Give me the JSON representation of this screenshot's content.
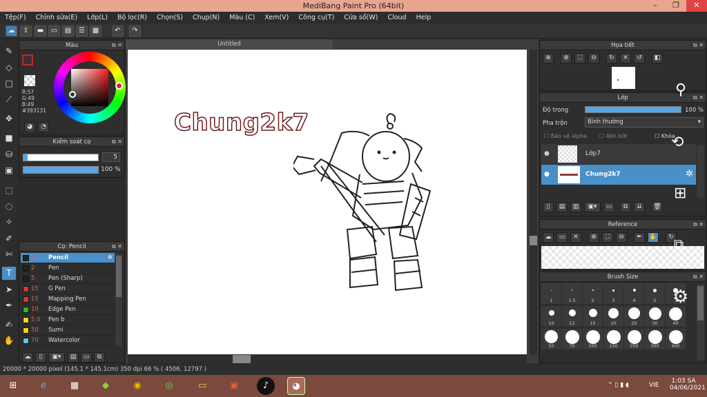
{
  "window": {
    "title": "MediBang Paint Pro (64bit)",
    "minimize": "–",
    "maximize": "❐",
    "close": "✕"
  },
  "menu": [
    "Tệp(F)",
    "Chỉnh sửa(E)",
    "Lớp(L)",
    "Bộ lọc(R)",
    "Chọn(S)",
    "Chụp(N)",
    "Màu (C)",
    "Xem(V)",
    "Công cụ(T)",
    "Cửa sổ(W)",
    "Cloud",
    "Help"
  ],
  "color_panel": {
    "title": "Màu",
    "r": "R:57",
    "g": "G:49",
    "b": "B:49",
    "hex": "#393131",
    "primary_color": "#393131",
    "accent": "#c2272d"
  },
  "brush_control": {
    "title": "Kiểm soát cọ",
    "size": "5",
    "opacity": "100 %",
    "opacity_fraction": 1.0
  },
  "brush_panel": {
    "title": "Cọ: Pencil",
    "items": [
      {
        "size": "5",
        "name": "Pencil",
        "color": "#222222",
        "selected": true
      },
      {
        "size": "2",
        "name": "Pen",
        "color": "#222222"
      },
      {
        "size": "5",
        "name": "Pen (Sharp)",
        "color": "#222222"
      },
      {
        "size": "15",
        "name": "G Pen",
        "color": "#e63131"
      },
      {
        "size": "15",
        "name": "Mapping Pen",
        "color": "#e63131"
      },
      {
        "size": "10",
        "name": "Edge Pen",
        "color": "#2db52d"
      },
      {
        "size": "5.0",
        "name": "Pen b",
        "color": "#f2d41d"
      },
      {
        "size": "50",
        "name": "Sumi",
        "color": "#f2d41d"
      },
      {
        "size": "70",
        "name": "Watercolor",
        "color": "#5bc8e8"
      }
    ]
  },
  "document": {
    "tab_title": "Untitled",
    "canvas_text": "Chung2k7"
  },
  "navigator": {
    "title": "Họa tiết"
  },
  "layers": {
    "title": "Lớp",
    "opacity_label": "Độ trong",
    "opacity_value": "100 %",
    "blend_label": "Pha trộn",
    "blend_value": "Bình thường",
    "protect_alpha": "Bảo vệ alpha",
    "clipping": "Xén bớt",
    "lock": "Khóa",
    "items": [
      {
        "name": "Lớp7",
        "selected": false
      },
      {
        "name": "Chung2k7",
        "selected": true
      }
    ]
  },
  "reference": {
    "title": "Reference"
  },
  "brush_size": {
    "title": "Brush Size",
    "sizes": [
      "1",
      "1.5",
      "2",
      "3",
      "4",
      "5",
      "7",
      "10",
      "12",
      "15",
      "20",
      "25",
      "30",
      "40",
      "50",
      "70",
      "100",
      "150",
      "200",
      "300",
      "400"
    ]
  },
  "status": {
    "text": "20000 * 20000 pixel   (145.1 * 145.1cm)   350 dpi   66 %   ( 4506, 12797 )"
  },
  "taskbar": {
    "lang": "VIE",
    "time": "1:03 SA",
    "date": "04/06/2021"
  }
}
